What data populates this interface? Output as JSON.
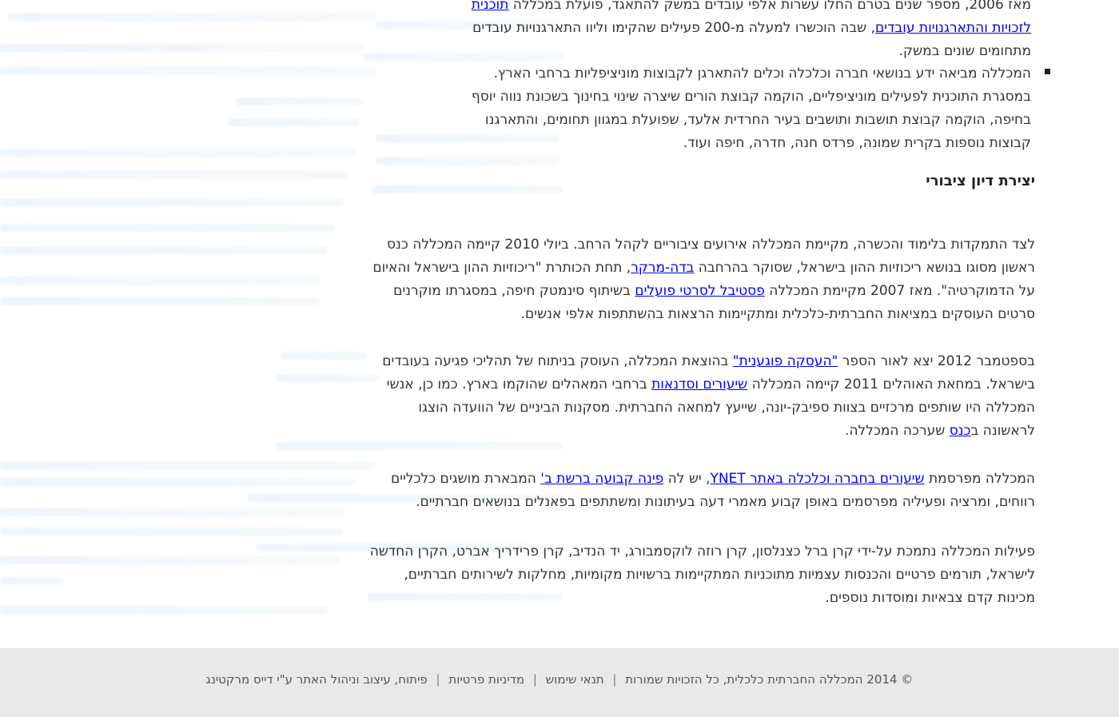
{
  "top": {
    "line1_prefix": "מאז 2006, מספר שנים בטרם החלו עשרות אלפי עובדים במשק להתאגד, פועלת במכללה ",
    "program_link": "תוכנית לזכויות והתארגנויות עובדים",
    "line1_suffix": ", שבה הוכשרו למעלה מ-200 פעילים שהקימו וליוו התארגנויות עובדים מתחומים שונים במשק."
  },
  "bullet": {
    "text": "המכללה מביאה ידע בנושאי חברה וכלכלה וכלים להתארגן לקבוצות מוניציפליות ברחבי הארץ. במסגרת התוכנית לפעילים מוניציפליים, הוקמה קבוצת הורים שיצרה שינוי בחינוך בשכונת נווה יוסף בחיפה, הוקמה קבוצת תושבות ותושבים בעיר החרדית אלעד, שפועלת במגוון תחומים, והתארגנו קבוצות נוספות בקרית שמונה, פרדס חנה,  חדרה, חיפה ועוד."
  },
  "section": {
    "title": "יצירת דיון ציבורי"
  },
  "p1": {
    "a": "לצד התמקדות בלימוד והכשרה, מקיימת המכללה אירועים ציבוריים לקהל הרחב. ביולי 2010 קיימה המכללה כנס ראשון מסוגו בנושא ריכוזיות ההון בישראל, שסוקר בהרחבה ",
    "link1": "בדה-מרקר",
    "b": ", תחת הכותרת \"ריכוזיות ההון בישראל והאיום על הדמוקרטיה\". מאז 2007 מקיימת המכללה ",
    "link2": "פסטיבל לסרטי פועלים",
    "c": " בשיתוף סינמטק חיפה, במסגרתו מוקרנים סרטים העוסקים במציאות החברתית-כלכלית ומתקיימות הרצאות בהשתתפות אלפי אנשים."
  },
  "p2": {
    "a": "בספטמבר 2012 יצא לאור הספר ",
    "link1": "\"העסקה פוגענית\"",
    "b": " בהוצאת המכללה, העוסק בניתוח של תהליכי פגיעה בעובדים בישראל. במחאת האוהלים 2011 קיימה המכללה ",
    "link2": "שיעורים וסדנאות",
    "c": " ברחבי המאהלים שהוקמו בארץ. כמו כן, אנשי המכללה היו שותפים מרכזיים בצוות ספיבק-יונה, שייעץ למחאה החברתית. מסקנות הביניים של הוועדה הוצגו לראשונה ב",
    "link3": "כנס",
    "d": " שערכה המכללה."
  },
  "p3": {
    "a": "המכללה מפרסמת ",
    "link1": "שיעורים בחברה וכלכלה באתר YNET",
    "b": ", יש לה ",
    "link2": "פינה קבועה ברשת ב'",
    "c": " המבארת מושגים כלכליים רווחים, ומרציה ופעיליה מפרסמים באופן קבוע מאמרי דעה בעיתונות ומשתתפים בפאנלים בנושאים חברתיים."
  },
  "p4": {
    "text": "פעילות המכללה נתמכת על-ידי  קרן ברל כצנלסון, קרן רוזה לוקסמבורג, יד הנדיב, קרן פרידריך אברט, הקרן החדשה לישראל, תורמים פרטיים והכנסות עצמיות מתוכניות המתקיימות ברשויות מקומיות, מחלקות לשירותים חברתיים, מכינות קדם צבאיות ומוסדות נוספים."
  },
  "footer": {
    "copyright": "© 2014 המכללה החברתית כלכלית, כל הזכויות שמורות",
    "terms": "תנאי שימוש",
    "privacy": "מדיניות פרטיות",
    "credits": "פיתוח, עיצוב וניהול האתר ע\"י דייס מרקטינג",
    "separator": "|"
  }
}
